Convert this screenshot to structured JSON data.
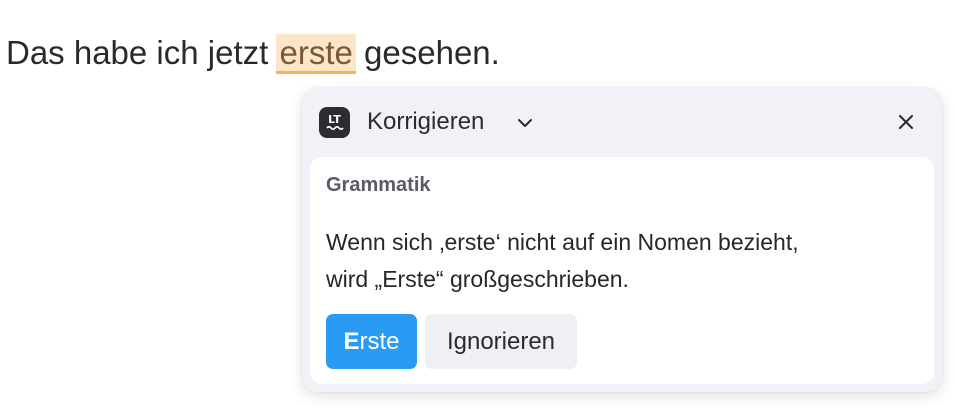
{
  "editor": {
    "text_before": "Das habe ich jetzt ",
    "flagged_word": "erste",
    "text_after": " gesehen."
  },
  "popup": {
    "mode_label": "Korrigieren",
    "logo_icon": "languagetool-logo-icon",
    "chevron_icon": "chevron-down-icon",
    "close_icon": "close-icon",
    "category": "Grammatik",
    "message_line1": "Wenn sich ‚erste‘ nicht auf ein Nomen bezieht,",
    "message_line2": "wird „Erste“ großgeschrieben.",
    "suggestion_first": "E",
    "suggestion_rest": "rste",
    "ignore_label": "Ignorieren"
  },
  "colors": {
    "highlight_bg": "#fbe6c8",
    "highlight_underline": "#f0b25e",
    "accent": "#2a9bf3",
    "popup_bg": "#f1f2f7"
  }
}
